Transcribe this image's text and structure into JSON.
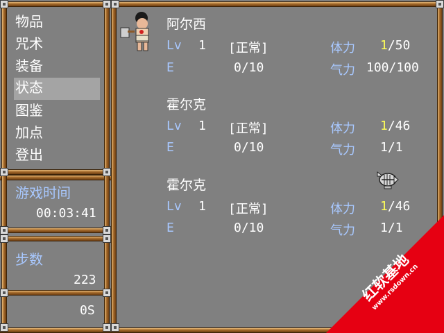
{
  "menu": {
    "items": [
      {
        "label": "物品"
      },
      {
        "label": "咒术"
      },
      {
        "label": "装备"
      },
      {
        "label": "状态"
      },
      {
        "label": "图鉴"
      },
      {
        "label": "加点"
      },
      {
        "label": "登出"
      }
    ],
    "selected_label": "状态"
  },
  "info": {
    "time_label": "游戏时间",
    "time_value": "00:03:41",
    "steps_label": "步数",
    "steps_value": "223",
    "money_value": "0S"
  },
  "party": [
    {
      "name": "阿尔西",
      "lv_label": "Lv",
      "lv": "1",
      "status": "[正常]",
      "hp_label": "体力",
      "hp_current": "1",
      "hp_max": "/50",
      "e_label": "E",
      "e_value": "0/10",
      "mp_label": "气力",
      "mp_value": "100/100",
      "sprite": "caveman-axe-icon"
    },
    {
      "name": "霍尔克",
      "lv_label": "Lv",
      "lv": "1",
      "status": "[正常]",
      "hp_label": "体力",
      "hp_current": "1",
      "hp_max": "/46",
      "e_label": "E",
      "e_value": "0/10",
      "mp_label": "气力",
      "mp_value": "1/1"
    },
    {
      "name": "霍尔克",
      "lv_label": "Lv",
      "lv": "1",
      "status": "[正常]",
      "hp_label": "体力",
      "hp_current": "1",
      "hp_max": "/46",
      "e_label": "E",
      "e_value": "0/10",
      "mp_label": "气力",
      "mp_value": "1/1",
      "sprite": "fish-bone-icon"
    }
  ],
  "watermark": {
    "brand": "红软基地",
    "url": "www.rsdown.cn"
  },
  "colors": {
    "background": "#808080",
    "label": "#a8c8ff",
    "highlight": "#ffff58",
    "bamboo": "#a46a2b",
    "watermark": "#e60012"
  }
}
